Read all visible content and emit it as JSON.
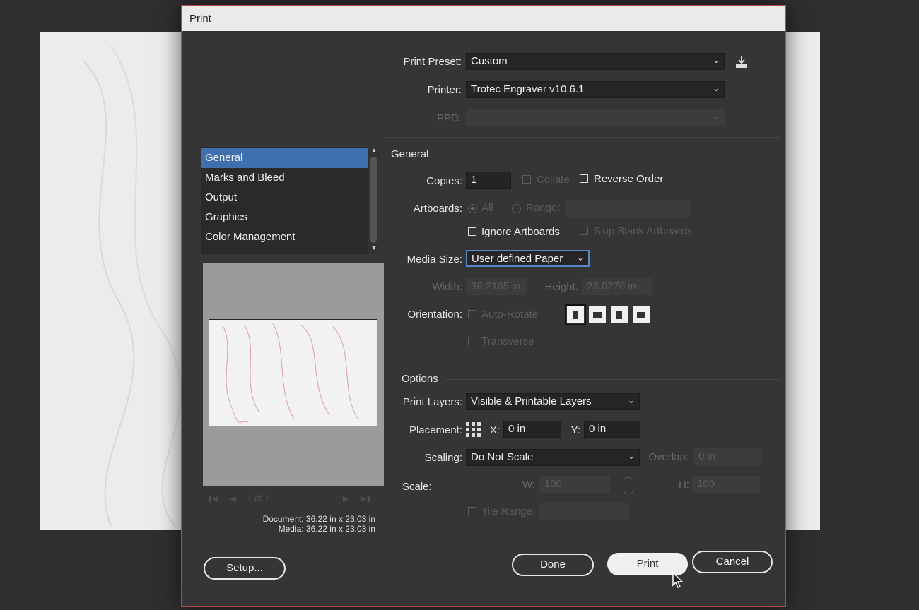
{
  "dialog": {
    "title": "Print"
  },
  "top": {
    "preset_label": "Print Preset:",
    "preset_value": "Custom",
    "printer_label": "Printer:",
    "printer_value": "Trotec Engraver v10.6.1",
    "ppd_label": "PPD:",
    "ppd_value": ""
  },
  "sidebar": {
    "items": [
      {
        "label": "General",
        "selected": true
      },
      {
        "label": "Marks and Bleed"
      },
      {
        "label": "Output"
      },
      {
        "label": "Graphics"
      },
      {
        "label": "Color Management"
      }
    ]
  },
  "preview": {
    "page_nav": "1 of 1",
    "document_label": "Document: 36.22 in x 23.03 in",
    "media_label": "Media: 36.22 in x 23.03 in"
  },
  "general": {
    "section_title": "General",
    "copies_label": "Copies:",
    "copies_value": "1",
    "collate_label": "Collate",
    "reverse_order_label": "Reverse Order",
    "artboards_label": "Artboards:",
    "all_label": "All",
    "range_label": "Range:",
    "ignore_artboards_label": "Ignore Artboards",
    "skip_blank_label": "Skip Blank Artboards",
    "media_size_label": "Media Size:",
    "media_size_value": "User defined Paper",
    "width_label": "Width:",
    "width_value": "36.2165 in",
    "height_label": "Height:",
    "height_value": "23.0276 in",
    "orientation_label": "Orientation:",
    "auto_rotate_label": "Auto-Rotate",
    "transverse_label": "Transverse"
  },
  "options": {
    "section_title": "Options",
    "print_layers_label": "Print Layers:",
    "print_layers_value": "Visible & Printable Layers",
    "placement_label": "Placement:",
    "x_label": "X:",
    "x_value": "0 in",
    "y_label": "Y:",
    "y_value": "0 in",
    "scaling_label": "Scaling:",
    "scaling_value": "Do Not Scale",
    "overlap_label": "Overlap:",
    "overlap_value": "0 in",
    "scale_label": "Scale:",
    "w_label": "W:",
    "w_value": "100",
    "h_label": "H:",
    "h_value": "100",
    "tile_range_label": "Tile Range:"
  },
  "buttons": {
    "setup": "Setup...",
    "done": "Done",
    "print": "Print",
    "cancel": "Cancel"
  }
}
